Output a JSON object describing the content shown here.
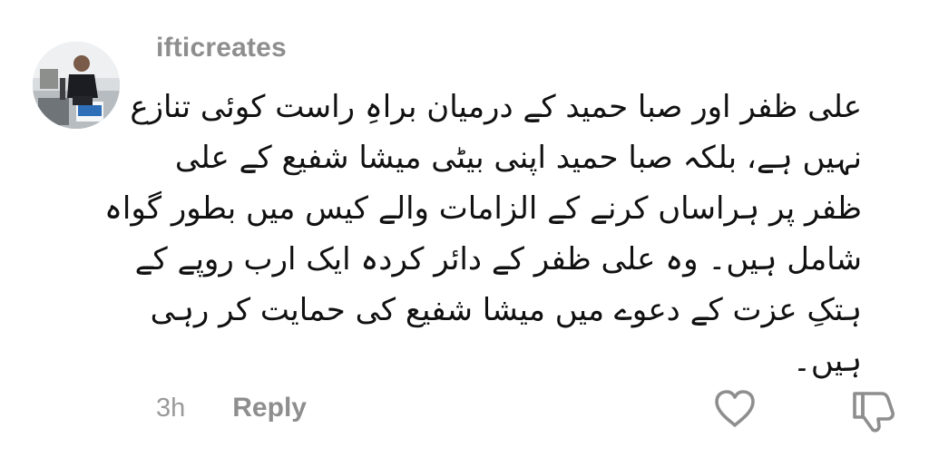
{
  "comment": {
    "username": "ifticreates",
    "lines": [
      "علی ظفر اور صبا حمید کے درمیان براہِ راست کوئی تنازع",
      "نہیں ہے، بلکہ صبا حمید اپنی بیٹی میشا شفیع کے علی",
      "ظفر پر ہراساں کرنے کے الزامات والے کیس میں بطور گواہ",
      "شامل ہیں۔ وہ علی ظفر کے دائر کردہ ایک ارب روپے کے",
      "ہتکِ عزت کے دعوے میں میشا شفیع کی حمایت کر رہی",
      "ہیں۔"
    ],
    "timestamp": "3h",
    "reply_label": "Reply"
  },
  "icons": {
    "like": "heart-icon",
    "dislike": "thumbs-down-icon"
  },
  "colors": {
    "username": "#8e8e8e",
    "body_text": "#111111",
    "meta_text": "#9a9a9a",
    "icon_stroke": "#8e8e8e"
  }
}
